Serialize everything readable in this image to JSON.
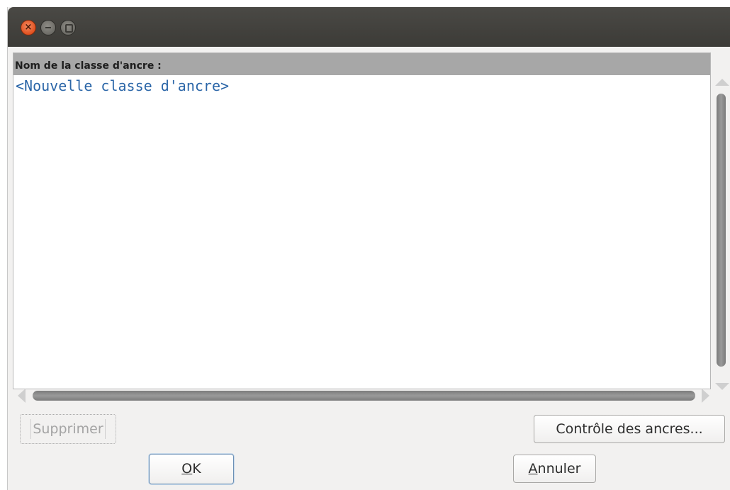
{
  "window": {
    "controls": {
      "close_icon": "close-icon",
      "minimize_icon": "minimize-icon",
      "maximize_icon": "maximize-icon"
    }
  },
  "list": {
    "header": "Nom de la classe d'ancre :",
    "items": [
      "<Nouvelle classe d'ancre>"
    ]
  },
  "buttons": {
    "delete": "Supprimer",
    "manage": "Contrôle des ancres...",
    "ok_mnemonic": "O",
    "ok_rest": "K",
    "cancel_mnemonic": "A",
    "cancel_rest": "nnuler"
  },
  "colors": {
    "titlebar": "#3c3b37",
    "close_button": "#e0501f",
    "list_header_bg": "#a7a7a7",
    "list_item_text": "#2b66a8",
    "window_bg": "#f2f1f0"
  }
}
